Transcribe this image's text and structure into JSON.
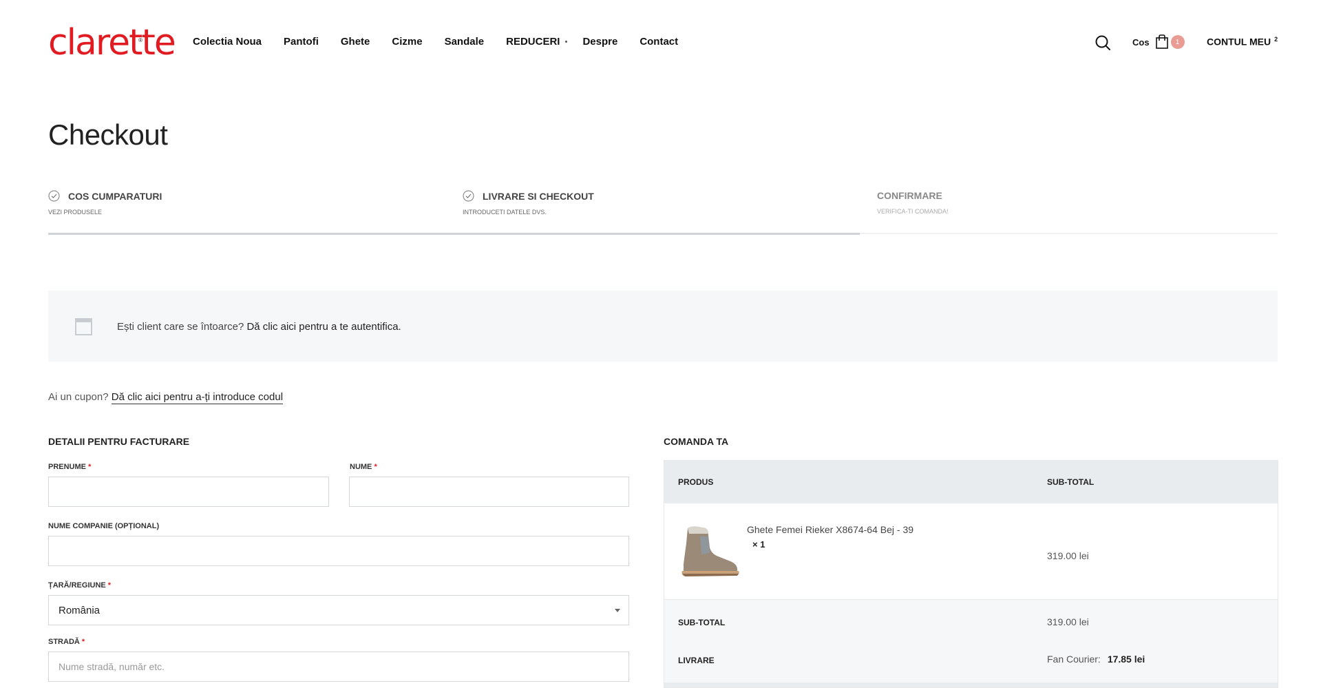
{
  "brand": {
    "logo_text": "clarette",
    "logo_mark": "®",
    "color": "#e01b22"
  },
  "nav": [
    {
      "label": "Colectia Noua"
    },
    {
      "label": "Pantofi"
    },
    {
      "label": "Ghete"
    },
    {
      "label": "Cizme"
    },
    {
      "label": "Sandale"
    },
    {
      "label": "REDUCERI",
      "has_submenu": true
    },
    {
      "label": "Despre"
    },
    {
      "label": "Contact"
    }
  ],
  "header": {
    "search_icon": "search-icon",
    "cart_label": "Cos",
    "cart_count": "1",
    "account_label": "CONTUL MEU",
    "account_count": "2"
  },
  "page": {
    "title": "Checkout"
  },
  "steps": [
    {
      "label": "COS CUMPARATURI",
      "sub": "VEZI PRODUSELE",
      "done": true
    },
    {
      "label": "LIVRARE SI CHECKOUT",
      "sub": "INTRODUCETI DATELE DVS.",
      "done": true
    },
    {
      "label": "CONFIRMARE",
      "sub": "VERIFICA-TI COMANDA!",
      "done": false
    }
  ],
  "steps_progress": 0.66,
  "notice": {
    "text": "Ești client care se întoarce?",
    "link": "Dă clic aici pentru a te autentifica."
  },
  "coupon": {
    "text": "Ai un cupon?",
    "link": "Dă clic aici pentru a-ți introduce codul"
  },
  "billing": {
    "title": "DETALII PENTRU FACTURARE",
    "first_name": {
      "label": "PRENUME",
      "value": "",
      "required": "*"
    },
    "last_name": {
      "label": "NUME",
      "value": "",
      "required": "*"
    },
    "company": {
      "label": "NUME COMPANIE (OPȚIONAL)",
      "value": ""
    },
    "country": {
      "label": "ȚARĂ/REGIUNE",
      "value": "România",
      "required": "*"
    },
    "street": {
      "label": "STRADĂ",
      "placeholder": "Nume stradă, număr etc.",
      "value": "",
      "required": "*"
    }
  },
  "order": {
    "title": "COMANDA TA",
    "col_product": "PRODUS",
    "col_subtotal": "SUB-TOTAL",
    "item": {
      "name": "Ghete Femei Rieker X8674-64 Bej - 39",
      "qty": "× 1",
      "price": "319.00 lei"
    },
    "subtotal_label": "SUB-TOTAL",
    "subtotal_value": "319.00 lei",
    "shipping_label": "LIVRARE",
    "shipping_method": "Fan Courier:",
    "shipping_price": "17.85 lei"
  }
}
